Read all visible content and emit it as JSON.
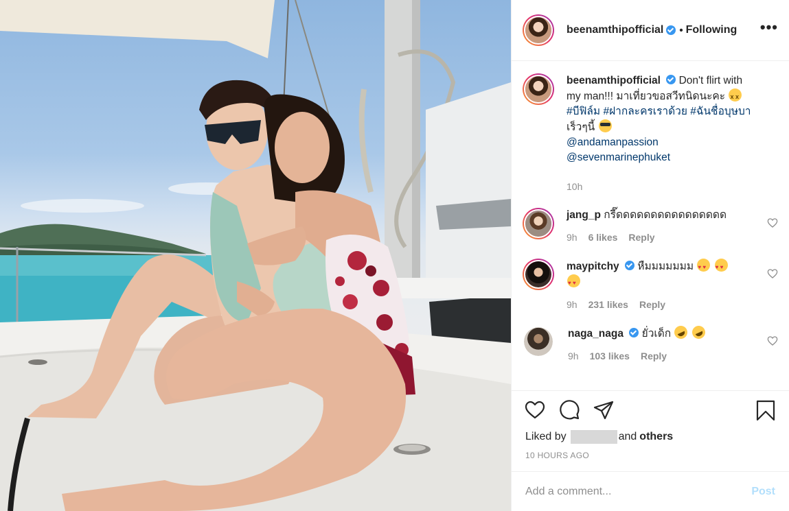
{
  "header": {
    "username": "beenamthipofficial",
    "separator": "•",
    "follow_state": "Following",
    "more_label": "•••"
  },
  "caption": {
    "username": "beenamthipofficial",
    "text_1": "Don't flirt with my man!!! มาเที่ยวขอสวีทนิดนะคะ",
    "hashtags": [
      "#บีฟิล์ม",
      "#ฝากละครเราด้วย",
      "#ฉันชื่อบุษบา"
    ],
    "text_2": "เร็วๆนี้",
    "mentions": [
      "@andamanpassion",
      "@sevenmarinephuket"
    ],
    "time": "10h"
  },
  "comments": [
    {
      "username": "jang_p",
      "verified": false,
      "text": "กรี๊ดดดดดดดดดดดดดดดด",
      "emojis": [],
      "time": "9h",
      "likes": "6 likes",
      "reply": "Reply"
    },
    {
      "username": "maypitchy",
      "verified": true,
      "text": "หืมมมมมมม",
      "emojis": [
        "heart-eyes-emoji",
        "heart-eyes-emoji",
        "heart-eyes-emoji"
      ],
      "time": "9h",
      "likes": "231 likes",
      "reply": "Reply"
    },
    {
      "username": "naga_naga",
      "verified": true,
      "text": "ยั่วเด็ก",
      "emojis": [
        "rofl-emoji",
        "rofl-emoji"
      ],
      "time": "9h",
      "likes": "103 likes",
      "reply": "Reply"
    }
  ],
  "actions": {
    "like_icon": "heart-icon",
    "comment_icon": "comment-icon",
    "share_icon": "paper-plane-icon",
    "save_icon": "bookmark-icon"
  },
  "likes_summary": {
    "prefix": "Liked by",
    "and": "and",
    "others": "others"
  },
  "timestamp": "10 HOURS AGO",
  "add_comment": {
    "placeholder": "Add a comment...",
    "post_label": "Post"
  },
  "colors": {
    "verified": "#3897f0",
    "link": "#00376b",
    "muted": "#8e8e8e",
    "post_button_disabled": "#b2dffc"
  }
}
